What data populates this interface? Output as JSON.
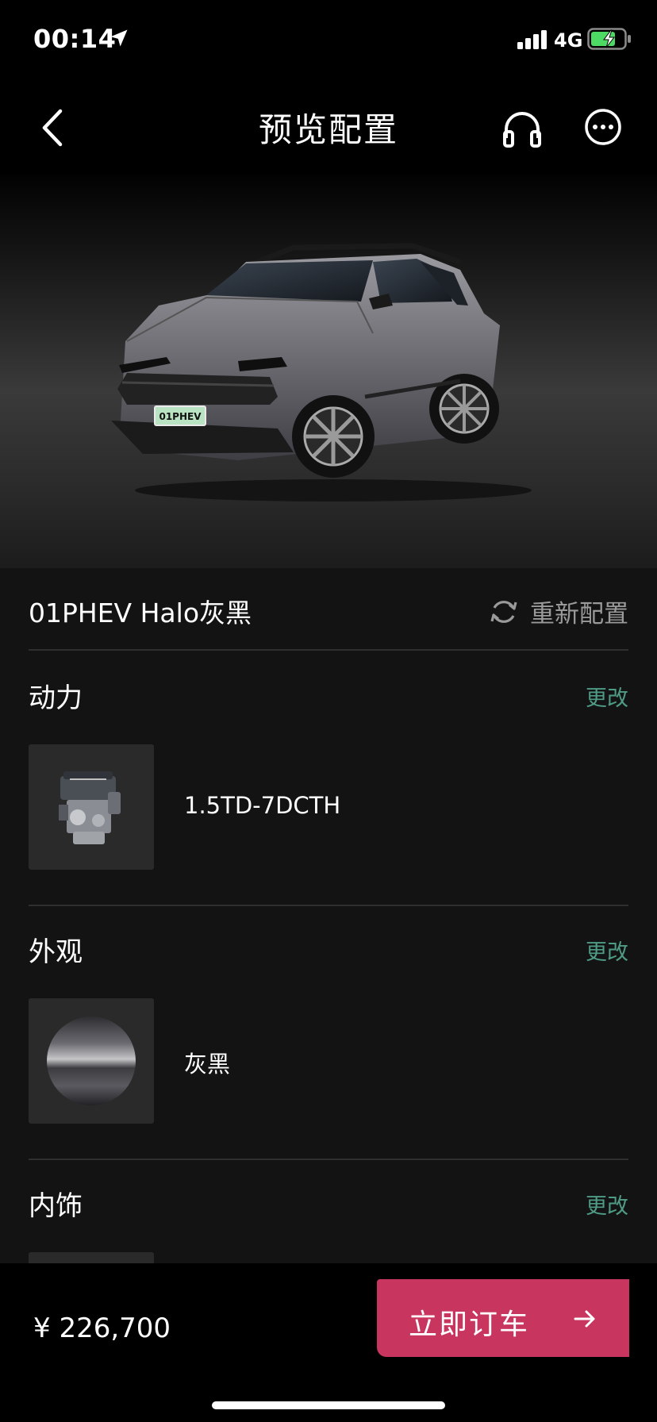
{
  "status_bar": {
    "time": "00:14",
    "network": "4G"
  },
  "nav": {
    "title": "预览配置"
  },
  "model": {
    "name": "01PHEV Halo灰黑",
    "reconfigure_label": "重新配置"
  },
  "sections": [
    {
      "title": "动力",
      "change_label": "更改",
      "option": "1.5TD-7DCTH"
    },
    {
      "title": "外观",
      "change_label": "更改",
      "option": "灰黑"
    },
    {
      "title": "内饰",
      "change_label": "更改"
    }
  ],
  "car": {
    "plate_text": "01PHEV"
  },
  "footer": {
    "price": "¥ 226,700",
    "order_label": "立即订车"
  },
  "colors": {
    "accent": "#c8355f",
    "link": "#4f9c86",
    "background": "#131313"
  }
}
